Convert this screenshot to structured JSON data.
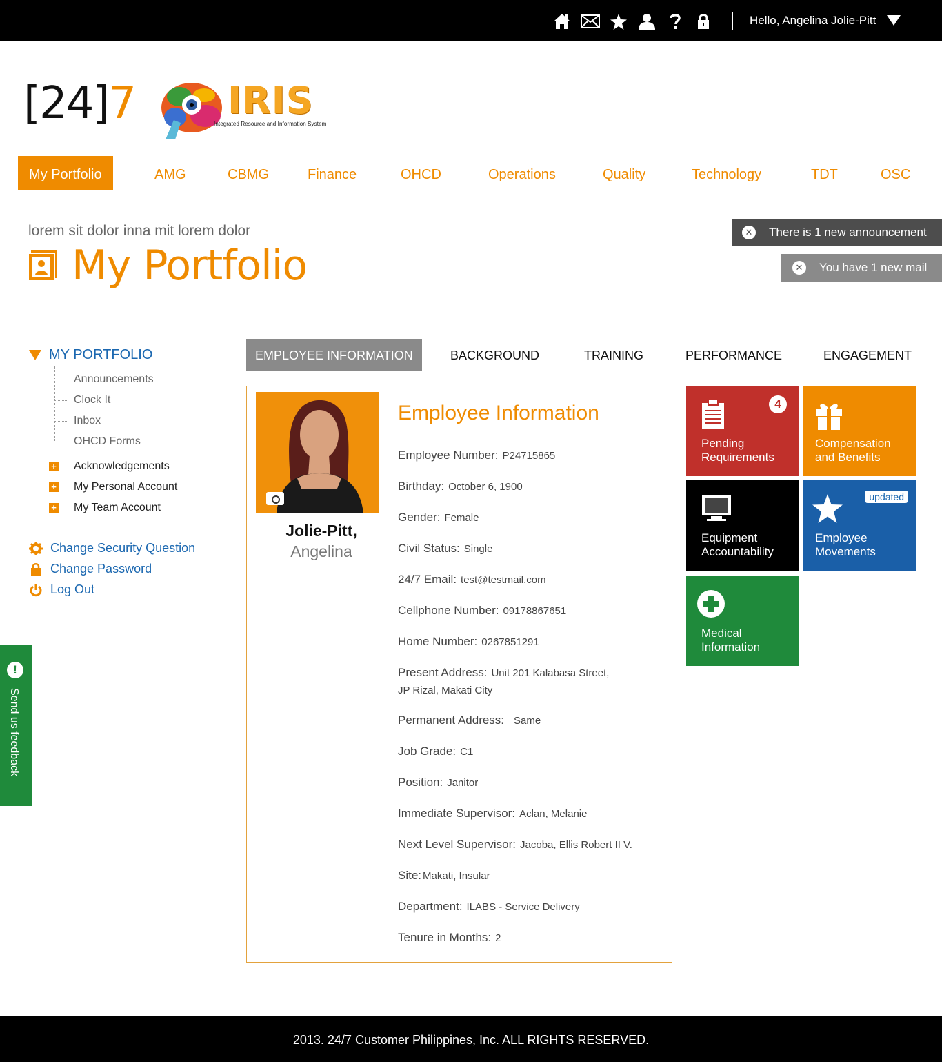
{
  "topbar": {
    "greeting": "Hello, Angelina Jolie-Pitt",
    "icons": [
      "home-icon",
      "mail-icon",
      "star-icon",
      "user-icon",
      "help-icon",
      "lock-icon"
    ]
  },
  "logo": {
    "brand_left": "[24]",
    "brand_right": "7",
    "iris_word": "IRIS",
    "iris_sub": "Integrated Resource and Information System"
  },
  "nav": [
    "My Portfolio",
    "AMG",
    "CBMG",
    "Finance",
    "OHCD",
    "Operations",
    "Quality",
    "Technology",
    "TDT",
    "OSC"
  ],
  "header": {
    "subtitle": "lorem sit dolor inna mit lorem dolor",
    "title": "My Portfolio"
  },
  "notices": {
    "announcement": "There is 1 new announcement",
    "mail": "You have 1 new mail"
  },
  "sidebar": {
    "heading": "MY PORTFOLIO",
    "sub_items": [
      "Announcements",
      "Clock It",
      "Inbox",
      "OHCD Forms"
    ],
    "expandable": [
      "Acknowledgements",
      "My Personal Account",
      "My Team Account"
    ],
    "links": [
      "Change Security Question",
      "Change Password",
      "Log Out"
    ]
  },
  "feedback": "Send us feedback",
  "tabs": [
    "EMPLOYEE INFORMATION",
    "BACKGROUND",
    "TRAINING",
    "PERFORMANCE",
    "ENGAGEMENT"
  ],
  "employee": {
    "last_name": "Jolie-Pitt,",
    "first_name": "Angelina",
    "card_title": "Employee Information",
    "fields": [
      {
        "label": "Employee Number:",
        "value": "P24715865"
      },
      {
        "label": "Birthday:",
        "value": "October 6, 1900"
      },
      {
        "label": "Gender:",
        "value": "Female"
      },
      {
        "label": "Civil Status:",
        "value": "Single"
      },
      {
        "label": "24/7 Email:",
        "value": "test@testmail.com"
      },
      {
        "label": "Cellphone Number:",
        "value": "09178867651"
      },
      {
        "label": "Home Number:",
        "value": "0267851291"
      },
      {
        "label": "Present Address:",
        "value": "Unit 201 Kalabasa Street,",
        "value2": "JP Rizal, Makati City"
      },
      {
        "label": "Permanent Address:",
        "value": "Same"
      },
      {
        "label": "Job Grade:",
        "value": "C1"
      },
      {
        "label": "Position:",
        "value": "Janitor"
      },
      {
        "label": "Immediate Supervisor:",
        "value": "Aclan, Melanie"
      },
      {
        "label": "Next Level Supervisor:",
        "value": "Jacoba, Ellis Robert II V."
      },
      {
        "label": "Site:",
        "value": "Makati, Insular"
      },
      {
        "label": "Department:",
        "value": "ILABS - Service Delivery"
      },
      {
        "label": "Tenure in Months:",
        "value": "2"
      }
    ]
  },
  "tiles": {
    "pending": {
      "line1": "Pending",
      "line2": "Requirements",
      "badge": "4",
      "color": "#c0302b"
    },
    "compensation": {
      "line1": "Compensation",
      "line2": "and Benefits",
      "color": "#ef8b00"
    },
    "equipment": {
      "line1": "Equipment",
      "line2": "Accountability",
      "color": "#000000"
    },
    "movements": {
      "line1": "Employee",
      "line2": "Movements",
      "badge": "updated",
      "color": "#1a5fa8"
    },
    "medical": {
      "line1": "Medical",
      "line2": "Information",
      "color": "#1f8a3b"
    }
  },
  "footer": "2013.  24/7 Customer Philippines, Inc. ALL RIGHTS RESERVED."
}
